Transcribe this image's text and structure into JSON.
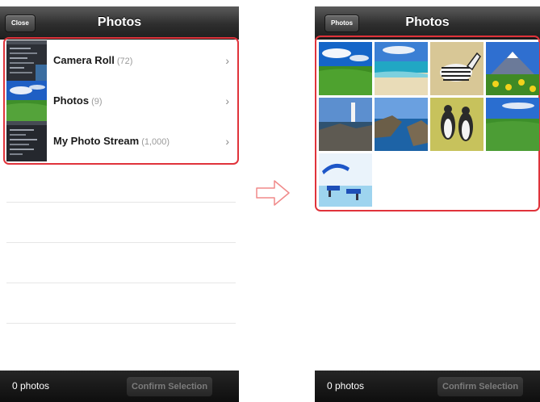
{
  "colors": {
    "highlight": "#e0333b",
    "navbar": "#2e2e2e",
    "toolbar": "#141414"
  },
  "left_screen": {
    "nav": {
      "title": "Photos",
      "close_button": "Close"
    },
    "albums": [
      {
        "name": "Camera Roll",
        "count": "(72)",
        "thumb": "screenshot-thumb"
      },
      {
        "name": "Photos",
        "count": "(9)",
        "thumb": "landscape-thumb"
      },
      {
        "name": "My Photo Stream",
        "count": "(1,000)",
        "thumb": "screenshot-thumb"
      }
    ],
    "toolbar": {
      "count_label": "0 photos",
      "confirm_label": "Confirm Selection"
    }
  },
  "arrow": {
    "icon": "right-arrow-icon"
  },
  "right_screen": {
    "nav": {
      "title": "Photos",
      "back_button": "Photos"
    },
    "photos": [
      {
        "subject": "grass-field"
      },
      {
        "subject": "beach"
      },
      {
        "subject": "zebra"
      },
      {
        "subject": "mountain-flowers"
      },
      {
        "subject": "lighthouse-coast"
      },
      {
        "subject": "bay-coast"
      },
      {
        "subject": "penguins"
      },
      {
        "subject": "green-field"
      },
      {
        "subject": "beach-chairs"
      }
    ],
    "toolbar": {
      "count_label": "0 photos",
      "confirm_label": "Confirm Selection"
    }
  }
}
